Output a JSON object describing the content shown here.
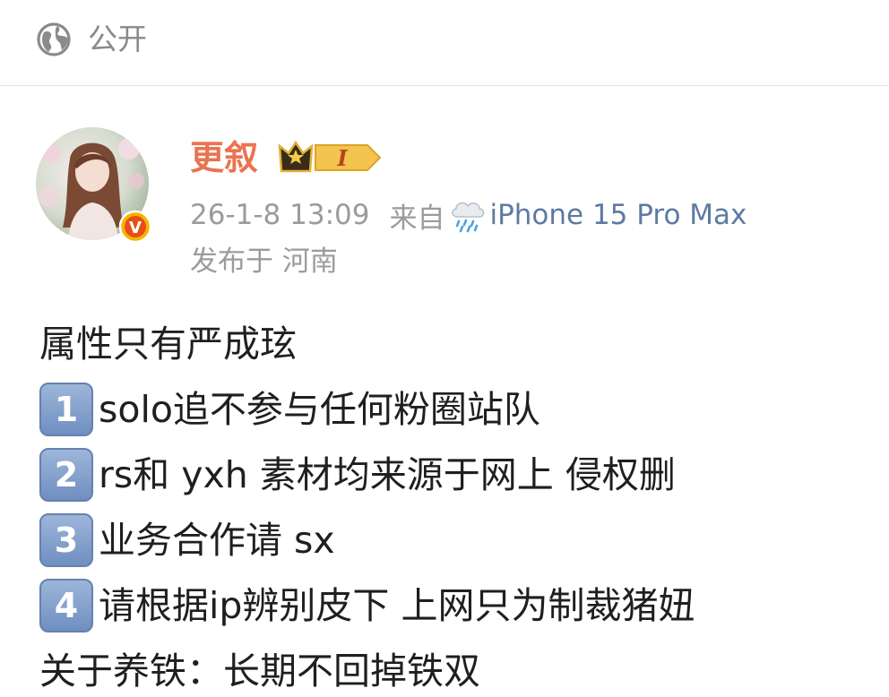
{
  "visibility": {
    "label": "公开",
    "icon": "globe-icon"
  },
  "post": {
    "author": {
      "name": "更叙",
      "verified": "V",
      "level_badge": "I"
    },
    "time": "26-1-8 13:09",
    "source_prefix": "来自",
    "source_icon": "rain-cloud-icon",
    "source_device": "iPhone 15 Pro Max",
    "location": "发布于 河南",
    "lines": [
      {
        "key": "",
        "text": "属性只有严成玹"
      },
      {
        "key": "1",
        "text": "solo追不参与任何粉圈站队"
      },
      {
        "key": "2",
        "text": "rs和 yxh 素材均来源于网上 侵权删"
      },
      {
        "key": "3",
        "text": "业务合作请 sx"
      },
      {
        "key": "4",
        "text": "请根据ip辨别皮下  上网只为制裁猪妞"
      },
      {
        "key": "",
        "text": "关于养铁：长期不回掉铁双"
      }
    ]
  },
  "colors": {
    "username": "#eb7350",
    "device": "#5d7aa3",
    "meta": "#9b9b9b",
    "text": "#1f1f1f",
    "key_fill": "#7f9fcc"
  }
}
